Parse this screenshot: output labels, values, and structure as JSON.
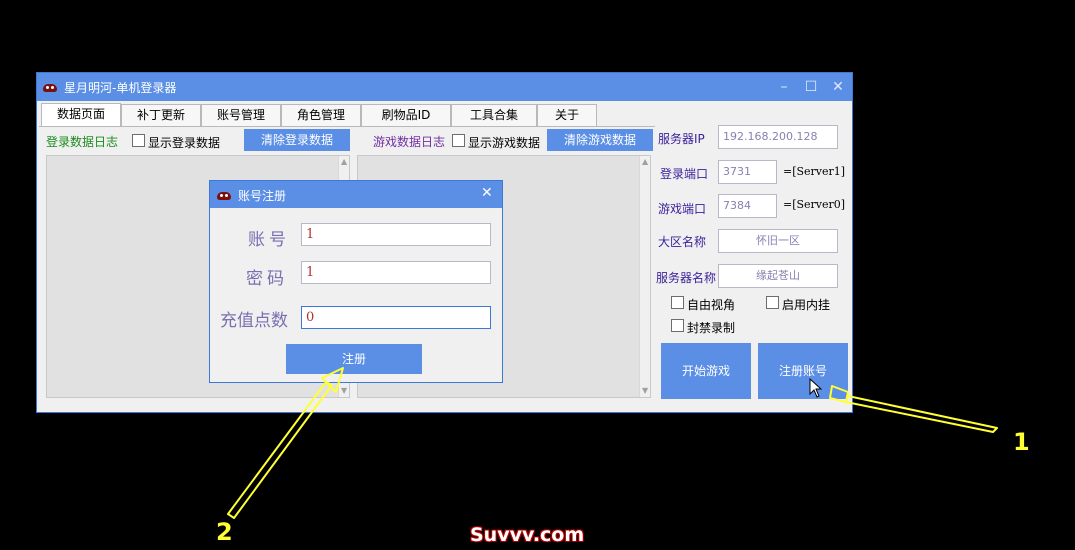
{
  "window": {
    "title": "星月明河-单机登录器",
    "controls": {
      "minimize": "–",
      "maximize": "☐",
      "close": "✕"
    }
  },
  "tabs": [
    {
      "label": "数据页面",
      "active": true
    },
    {
      "label": "补丁更新"
    },
    {
      "label": "账号管理"
    },
    {
      "label": "角色管理"
    },
    {
      "label": "刷物品ID"
    },
    {
      "label": "工具合集"
    },
    {
      "label": "关于"
    }
  ],
  "login_log": {
    "title": "登录数据日志",
    "show_checkbox_label": "显示登录数据",
    "clear_button": "清除登录数据"
  },
  "game_log": {
    "title": "游戏数据日志",
    "show_checkbox_label": "显示游戏数据",
    "clear_button": "清除游戏数据"
  },
  "server": {
    "ip_label": "服务器IP",
    "ip_value": "192.168.200.128",
    "login_port_label": "登录端口",
    "login_port_value": "3731",
    "login_port_tag": "=[Server1]",
    "game_port_label": "游戏端口",
    "game_port_value": "7384",
    "game_port_tag": "=[Server0]",
    "region_label": "大区名称",
    "region_value": "怀旧一区",
    "server_name_label": "服务器名称",
    "server_name_value": "缘起苍山"
  },
  "options": {
    "free_view": "自由视角",
    "enable_plugin": "启用内挂",
    "block_record": "封禁录制"
  },
  "actions": {
    "start_game": "开始游戏",
    "register_account": "注册账号"
  },
  "dialog": {
    "title": "账号注册",
    "close": "✕",
    "account_label": "账号",
    "account_value": "1",
    "password_label": "密码",
    "password_value": "1",
    "points_label": "充值点数",
    "points_value": "0",
    "register_button": "注册"
  },
  "annotations": {
    "marker_1": "1",
    "marker_2": "2",
    "annotation_color": "#ffff33"
  },
  "watermark": "Suvvv.com",
  "colors": {
    "accent": "#5b8fe6",
    "label_green": "#1c8c1c",
    "label_purple": "#7030a0"
  }
}
